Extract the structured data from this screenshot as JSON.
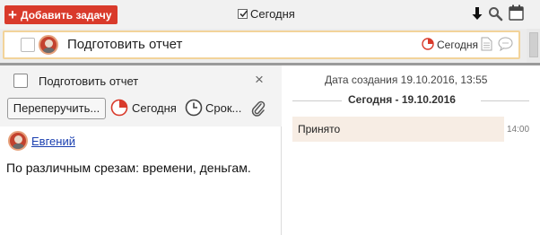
{
  "toolbar": {
    "add_task_label": "Добавить задачу",
    "today_filter_label": "Сегодня",
    "today_filter_checked": true
  },
  "task_row": {
    "title": "Подготовить отчет",
    "due_label": "Сегодня"
  },
  "task_detail": {
    "title": "Подготовить отчет",
    "reassign_label": "Переперучить...",
    "due_label": "Сегодня",
    "deadline_label": "Срок...",
    "assignee_name": "Евгений",
    "description": "По различным срезам: времени, деньгам."
  },
  "history": {
    "created_label": "Дата создания 19.10.2016, 13:55",
    "date_heading": "Сегодня - 19.10.2016",
    "entries": [
      {
        "text": "Принято",
        "time": "14:00"
      }
    ]
  },
  "colors": {
    "accent_red": "#d93a2b",
    "row_highlight": "#f2d39a",
    "comment_bg": "#f7ede4",
    "link": "#1a3fb0"
  }
}
